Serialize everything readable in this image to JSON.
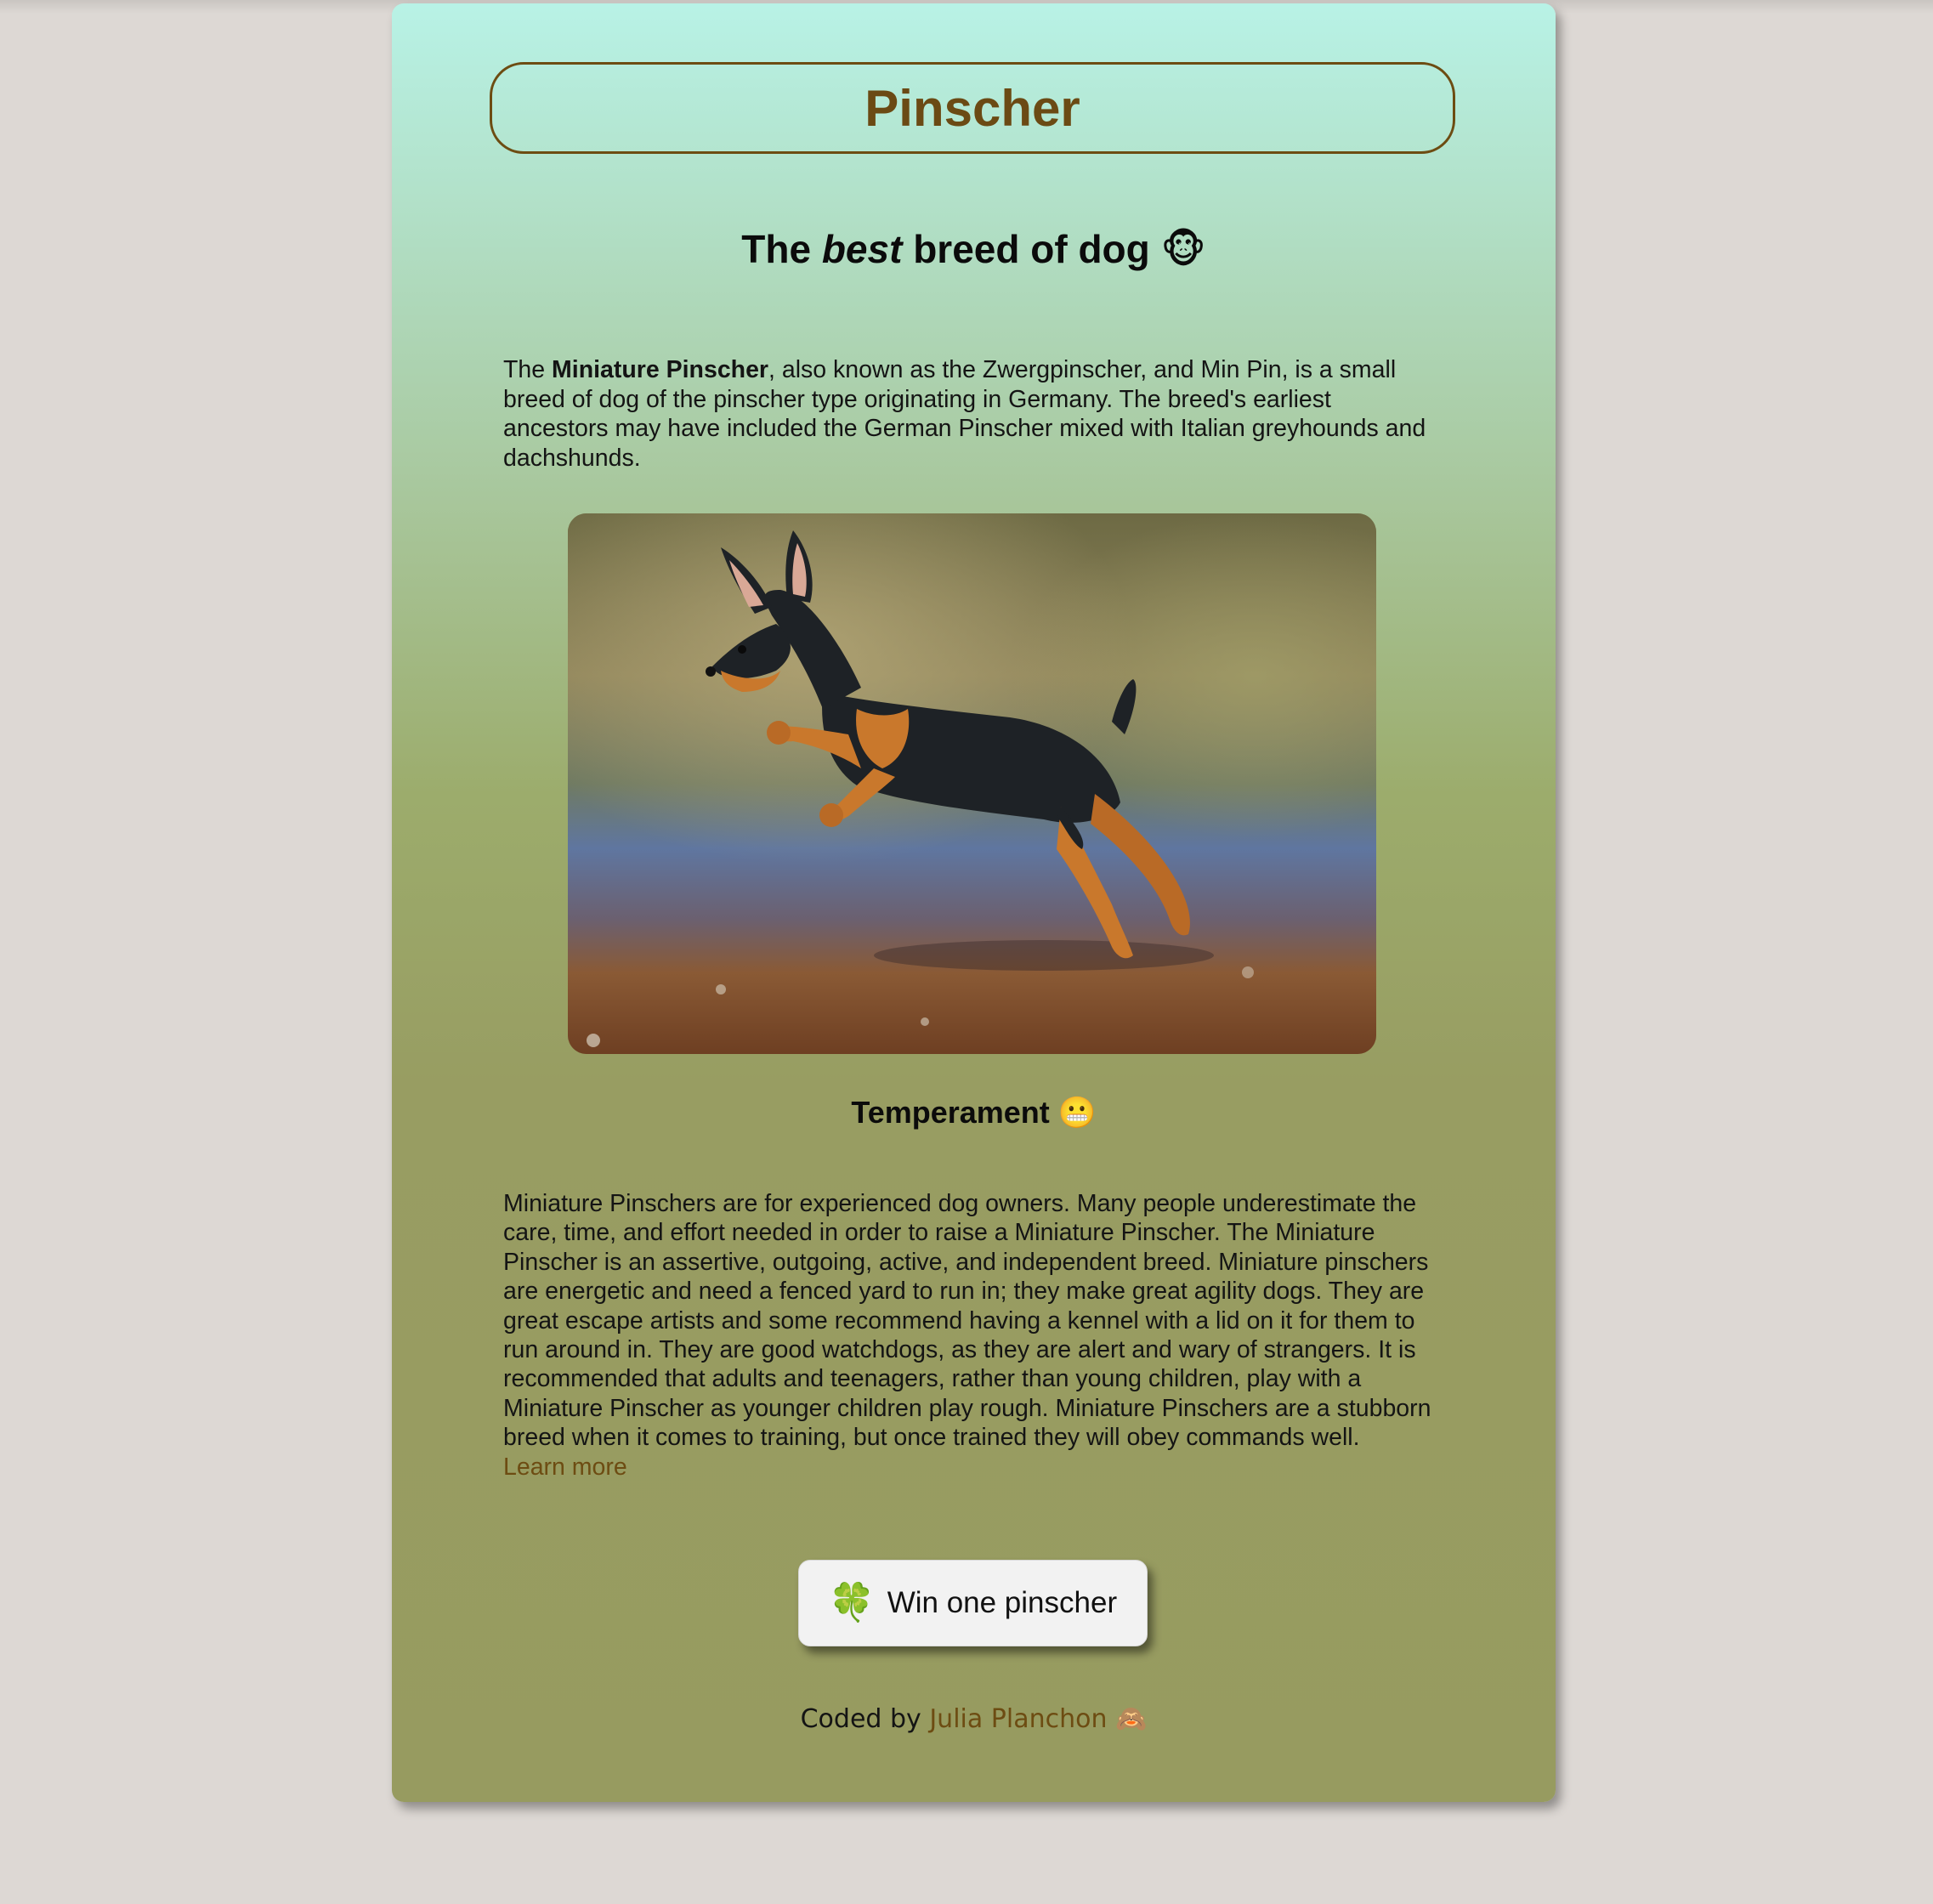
{
  "header": {
    "title": "Pinscher"
  },
  "subtitle": {
    "prefix": "The ",
    "emphasis": "best",
    "suffix": " breed of dog ",
    "emoji": "🐵"
  },
  "intro": {
    "lead": "The ",
    "bold": "Miniature Pinscher",
    "rest": ", also known as the Zwergpinscher, and Min Pin, is a small breed of dog of the pinscher type originating in Germany. The breed's earliest ancestors may have included the German Pinscher mixed with Italian greyhounds and dachshunds."
  },
  "photo": {
    "alt": "Miniature Pinscher jumping on a beach"
  },
  "temperament": {
    "title": "Temperament ",
    "emoji": "😬",
    "text": "Miniature Pinschers are for experienced dog owners. Many people underestimate the care, time, and effort needed in order to raise a Miniature Pinscher. The Miniature Pinscher is an assertive, outgoing, active, and independent breed. Miniature pinschers are energetic and need a fenced yard to run in; they make great agility dogs. They are great escape artists and some recommend having a kennel with a lid on it for them to run around in. They are good watchdogs, as they are alert and wary of strangers. It is recommended that adults and teenagers, rather than young children, play with a Miniature Pinscher as younger children play rough. Miniature Pinschers are a stubborn breed when it comes to training, but once trained they will obey commands well.",
    "learn_more": "Learn more"
  },
  "cta": {
    "icon": "🍀",
    "label": "Win one pinscher"
  },
  "footer": {
    "prefix": "Coded by ",
    "author": "Julia Planchon",
    "emoji": "🙈"
  },
  "colors": {
    "accent": "#6d4c12",
    "background": "#ddd8d4",
    "gradient_top": "#b8f2e6",
    "gradient_bottom": "#979b60"
  }
}
